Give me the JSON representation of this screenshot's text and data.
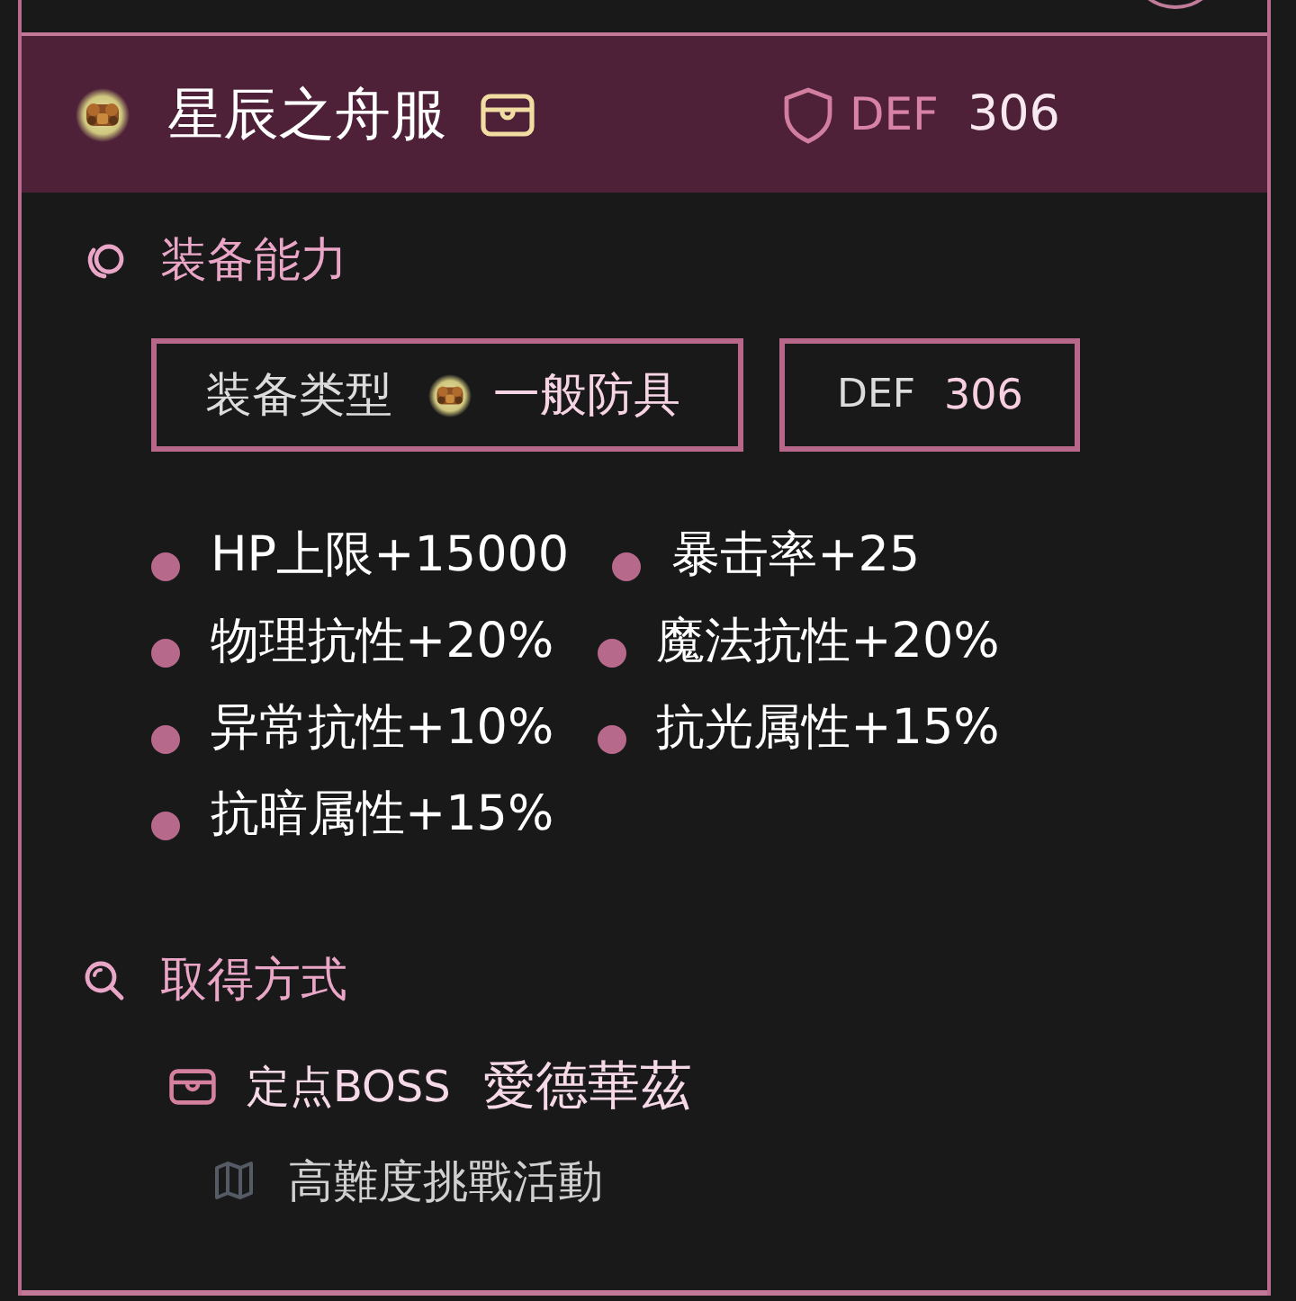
{
  "item": {
    "name": "星辰之舟服",
    "stat": {
      "label": "DEF",
      "value": "306"
    }
  },
  "abilities": {
    "title": "装备能力",
    "type": {
      "label": "装备类型",
      "value": "一般防具"
    },
    "stat": {
      "label": "DEF",
      "value": "306"
    },
    "effects": [
      "HP上限+15000",
      "暴击率+25",
      "物理抗性+20%",
      "魔法抗性+20%",
      "异常抗性+10%",
      "抗光属性+15%",
      "抗暗属性+15%"
    ]
  },
  "acquisition": {
    "title": "取得方式",
    "sources": [
      {
        "label": "定点BOSS",
        "name": "愛德華茲",
        "events": [
          "高難度挑戰活動"
        ]
      }
    ]
  }
}
